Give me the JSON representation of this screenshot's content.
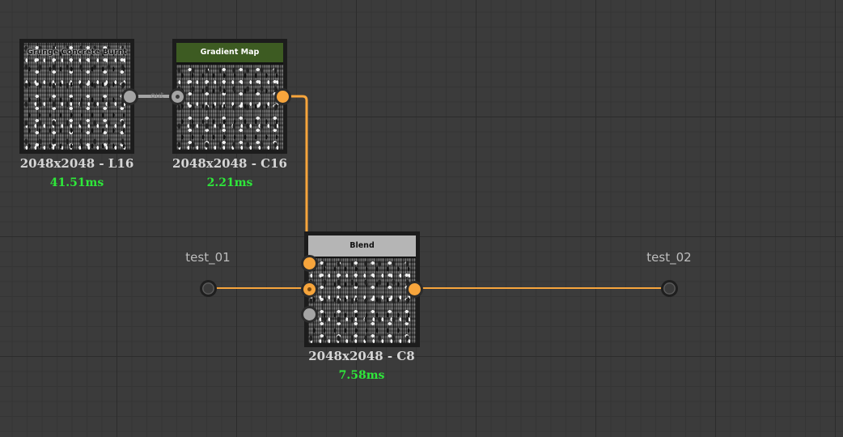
{
  "graph": {
    "nodes": [
      {
        "id": "grunge",
        "title": "Grunge Concrete Burnt",
        "header_style": "overlay",
        "resolution": "2048x2048 - L16",
        "timing": "41.51ms"
      },
      {
        "id": "gradient",
        "title": "Gradient Map",
        "header_style": "green",
        "resolution": "2048x2048 - C16",
        "timing": "2.21ms"
      },
      {
        "id": "blend",
        "title": "Blend",
        "header_style": "gray",
        "resolution": "2048x2048 - C8",
        "timing": "7.58ms"
      }
    ],
    "io": {
      "input_label": "test_01",
      "output_label": "test_02"
    },
    "connection_label": "out"
  },
  "colors": {
    "background": "#3b3b3b",
    "wire_color": "#f7a53c",
    "gray_wire": "#a4a4a4",
    "timing_text": "#2ee83a",
    "gradient_header": "#3d5b22",
    "blend_header": "#b5b5b5"
  }
}
